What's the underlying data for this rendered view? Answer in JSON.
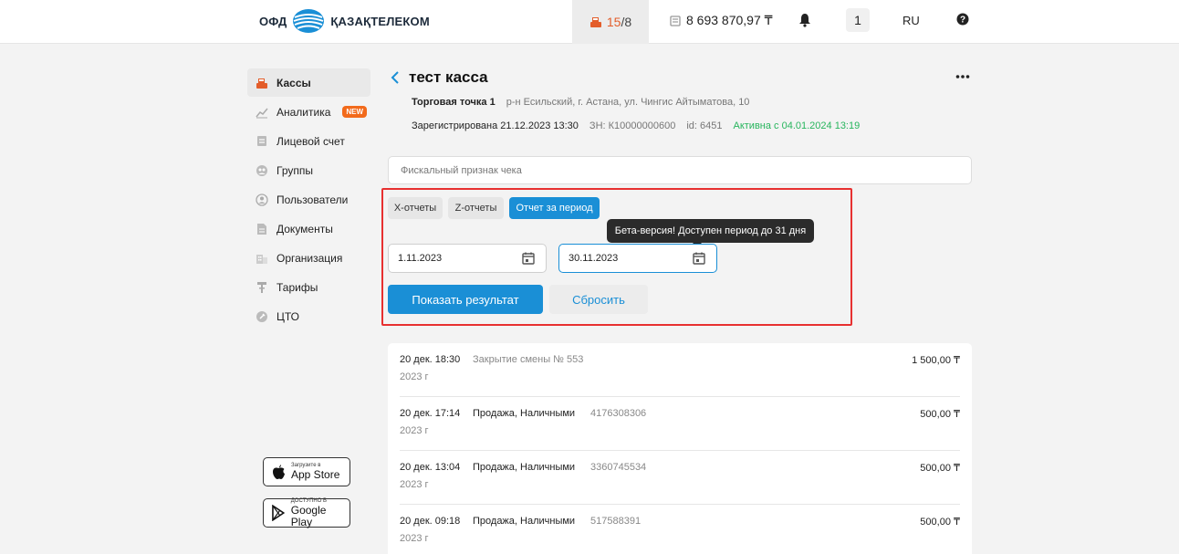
{
  "header": {
    "logo_text_left": "ОФД",
    "logo_text_right": "ҚАЗАҚТЕЛЕКОМ",
    "kassy_count_active": "15",
    "kassy_count_total": "/8",
    "balance": "8 693 870,97 ₸",
    "notifications_count": "1",
    "language": "RU"
  },
  "sidebar": {
    "items": [
      {
        "label": "Кассы",
        "icon": "cash-register-icon"
      },
      {
        "label": "Аналитика",
        "icon": "chart-icon",
        "badge": "NEW"
      },
      {
        "label": "Лицевой счет",
        "icon": "wallet-icon"
      },
      {
        "label": "Группы",
        "icon": "groups-icon"
      },
      {
        "label": "Пользователи",
        "icon": "user-icon"
      },
      {
        "label": "Документы",
        "icon": "document-icon"
      },
      {
        "label": "Организация",
        "icon": "building-icon"
      },
      {
        "label": "Тарифы",
        "icon": "tariff-icon"
      },
      {
        "label": "ЦТО",
        "icon": "cto-icon"
      }
    ],
    "app_store": {
      "small": "Загрузите в",
      "big": "App Store"
    },
    "google_play": {
      "small": "ДОСТУПНО В",
      "big": "Google Play"
    }
  },
  "kassa": {
    "title": "тест касса",
    "point_name": "Торговая точка 1",
    "address": "р-н Есильский, г. Астана, ул. Чингис Айтыматова, 10",
    "registered": "Зарегистрирована 21.12.2023 13:30",
    "zn": "ЗН: К10000000600",
    "id": "id: 6451",
    "active_since": "Активна с 04.01.2024 13:19"
  },
  "search": {
    "placeholder": "Фискальный признак чека"
  },
  "tabs": [
    {
      "label": "Х-отчеты"
    },
    {
      "label": "Z-отчеты"
    },
    {
      "label": "Отчет за период"
    }
  ],
  "tooltip": "Бета-версия! Доступен период до 31 дня",
  "period": {
    "from": "1.11.2023",
    "to": "30.11.2023"
  },
  "buttons": {
    "show": "Показать результат",
    "reset": "Сбросить"
  },
  "receipts": [
    {
      "date": "20 дек. 18:30",
      "year": "2023 г",
      "operation": "Закрытие смены № 553",
      "number": "",
      "sum": "1 500,00 ₸"
    },
    {
      "date": "20 дек. 17:14",
      "year": "2023 г",
      "operation": "Продажа, Наличными",
      "number": "4176308306",
      "sum": "500,00 ₸"
    },
    {
      "date": "20 дек. 13:04",
      "year": "2023 г",
      "operation": "Продажа, Наличными",
      "number": "3360745534",
      "sum": "500,00 ₸"
    },
    {
      "date": "20 дек. 09:18",
      "year": "2023 г",
      "operation": "Продажа, Наличными",
      "number": "517588391",
      "sum": "500,00 ₸"
    }
  ],
  "colors": {
    "accent": "#1a8fd6",
    "active_green": "#27b55d",
    "highlight_red": "#e73030",
    "brand_orange": "#e35d2a"
  }
}
